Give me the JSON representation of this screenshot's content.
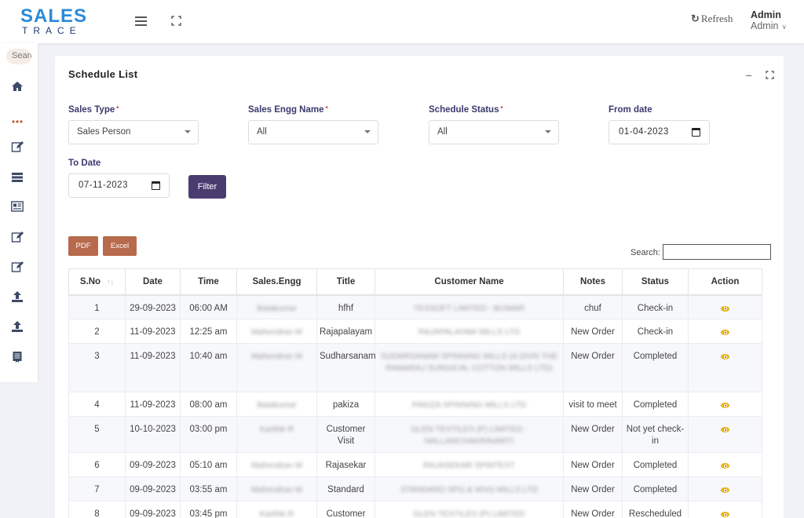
{
  "app": {
    "logo_top": "SALES",
    "logo_bottom": "TRACE"
  },
  "header": {
    "refresh_label": "Refresh",
    "user_name": "Admin",
    "user_role": "Admin"
  },
  "sidebar": {
    "search_placeholder": "Search",
    "items": [
      "home-icon",
      "more-icon",
      "edit-icon",
      "list-icon",
      "news-icon",
      "edit-icon",
      "edit-icon",
      "upload-icon",
      "upload-icon",
      "report-icon"
    ]
  },
  "card": {
    "title": "Schedule List"
  },
  "filters": {
    "sales_type_label": "Sales Type",
    "sales_type_value": "Sales Person",
    "sales_engg_label": "Sales Engg Name",
    "sales_engg_value": "All",
    "status_label": "Schedule Status",
    "status_value": "All",
    "from_label": "From date",
    "from_value": "01-04-2023",
    "to_label": "To Date",
    "to_value": "07-11-2023",
    "filter_button": "Filter",
    "required_mark": "*"
  },
  "export": {
    "pdf": "PDF",
    "excel": "Excel"
  },
  "search": {
    "label": "Search:"
  },
  "table": {
    "columns": [
      "S.No",
      "Date",
      "Time",
      "Sales.Engg",
      "Title",
      "Customer Name",
      "Notes",
      "Status",
      "Action"
    ],
    "rows": [
      {
        "sno": "1",
        "date": "29-09-2023",
        "time": "06:00 AM",
        "engg": "Balakumar",
        "title": "hfhf",
        "customer": "TEXSOFT LIMITED - BIJWAR",
        "notes": "chuf",
        "status": "Check-in"
      },
      {
        "sno": "2",
        "date": "11-09-2023",
        "time": "12:25 am",
        "engg": "Mahendran M",
        "title": "Rajapalayam",
        "customer": "RAJAPALAYAM MILLS LTD",
        "notes": "New Order",
        "status": "Check-in"
      },
      {
        "sno": "3",
        "date": "11-09-2023",
        "time": "10:40 am",
        "engg": "Mahendran M",
        "title": "Sudharsanam",
        "customer": "SUDARSANAM SPINNING MILLS (A DIVN THE RAMARAJ SURGICAL COTTON MILLS LTD)",
        "notes": "New Order",
        "status": "Completed"
      },
      {
        "sno": "4",
        "date": "11-09-2023",
        "time": "08:00 am",
        "engg": "Balakumar",
        "title": "pakiza",
        "customer": "PAKIZA SPINNING MILLS LTD",
        "notes": "visit to meet",
        "status": "Completed"
      },
      {
        "sno": "5",
        "date": "10-10-2023",
        "time": "03:00 pm",
        "engg": "Karthik R",
        "title": "Customer Visit",
        "customer": "GLEN TEXTILES (P) LIMITED - NALLANCHAKRAVARTI",
        "notes": "New Order",
        "status": "Not yet check-in"
      },
      {
        "sno": "6",
        "date": "09-09-2023",
        "time": "05:10 am",
        "engg": "Mahendran M",
        "title": "Rajasekar",
        "customer": "RAJASEKAR SPINTEXT",
        "notes": "New Order",
        "status": "Completed"
      },
      {
        "sno": "7",
        "date": "09-09-2023",
        "time": "03:55 am",
        "engg": "Mahendran M",
        "title": "Standard",
        "customer": "STANDARD SPG & WVG MILLS LTD",
        "notes": "New Order",
        "status": "Completed"
      },
      {
        "sno": "8",
        "date": "09-09-2023",
        "time": "03:45 pm",
        "engg": "Karthik R",
        "title": "Customer",
        "customer": "GLEN TEXTILES (P) LIMITED",
        "notes": "New Order",
        "status": "Rescheduled"
      }
    ]
  },
  "colors": {
    "brand": "#2b8ad8",
    "filter_button": "#4b3c70",
    "export_button": "#b76a4c",
    "eye_icon": "#e6b31d"
  }
}
